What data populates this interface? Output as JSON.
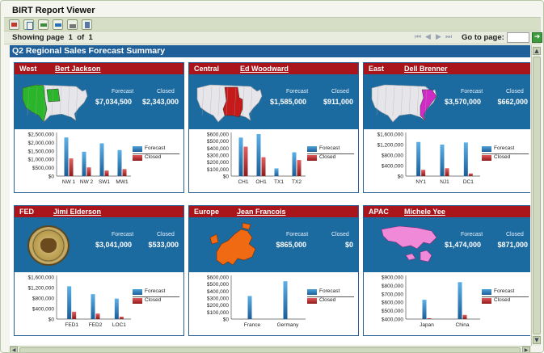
{
  "app": {
    "title": "BIRT Report Viewer"
  },
  "toolbar": {
    "icons": [
      "pdf-export-icon",
      "toc-icon",
      "export-report-icon",
      "export-data-icon",
      "print-icon",
      "print-server-icon"
    ]
  },
  "nav": {
    "showing_prefix": "Showing page",
    "page": "1",
    "of_label": "of",
    "total": "1",
    "goto_label": "Go to page:",
    "goto_value": "",
    "goto_button": "➜"
  },
  "report": {
    "title": "Q2 Regional Sales Forecast Summary"
  },
  "labels": {
    "forecast": "Forecast",
    "closed": "Closed"
  },
  "colors": {
    "header_red": "#a9151b",
    "panel_blue": "#1b6aa0",
    "title_blue": "#1f5f9a",
    "forecast_bar": "#2b7cc1",
    "closed_bar": "#b22222"
  },
  "panels": [
    {
      "region": "West",
      "rep": "Bert Jackson",
      "forecast": "$7,034,500",
      "closed": "$2,343,000",
      "image": "us-map-west",
      "chart_data": {
        "type": "bar",
        "categories": [
          "NW 1",
          "NW 2",
          "SW1",
          "MW1"
        ],
        "series": [
          {
            "name": "Forecast",
            "values": [
              2300000,
              1450000,
              1950000,
              1550000
            ]
          },
          {
            "name": "Closed",
            "values": [
              1050000,
              520000,
              330000,
              420000
            ]
          }
        ],
        "ylim": [
          0,
          2500000
        ],
        "yticks": [
          "$0",
          "$500,000",
          "$1,000,000",
          "$1,500,000",
          "$2,000,000",
          "$2,500,000"
        ]
      }
    },
    {
      "region": "Central",
      "rep": "Ed Woodward",
      "forecast": "$1,585,000",
      "closed": "$911,000",
      "image": "us-map-central",
      "chart_data": {
        "type": "bar",
        "categories": [
          "CH1",
          "OH1",
          "TX1",
          "TX2"
        ],
        "series": [
          {
            "name": "Forecast",
            "values": [
              550000,
              600000,
              110000,
              340000
            ]
          },
          {
            "name": "Closed",
            "values": [
              420000,
              270000,
              0,
              230000
            ]
          }
        ],
        "ylim": [
          0,
          600000
        ],
        "yticks": [
          "$0",
          "$100,000",
          "$200,000",
          "$300,000",
          "$400,000",
          "$500,000",
          "$600,000"
        ]
      }
    },
    {
      "region": "East",
      "rep": "Dell Brenner",
      "forecast": "$3,570,000",
      "closed": "$662,000",
      "image": "us-map-east",
      "chart_data": {
        "type": "bar",
        "categories": [
          "NY1",
          "NJ1",
          "DC1"
        ],
        "series": [
          {
            "name": "Forecast",
            "values": [
              1300000,
              1200000,
              1280000
            ]
          },
          {
            "name": "Closed",
            "values": [
              240000,
              300000,
              100000
            ]
          }
        ],
        "ylim": [
          0,
          1600000
        ],
        "yticks": [
          "$0",
          "$400,000",
          "$800,000",
          "$1,200,000",
          "$1,600,000"
        ]
      }
    },
    {
      "region": "FED",
      "rep": "Jimi Elderson",
      "forecast": "$3,041,000",
      "closed": "$533,000",
      "image": "great-seal",
      "chart_data": {
        "type": "bar",
        "categories": [
          "FED1",
          "FED2",
          "LOC1"
        ],
        "series": [
          {
            "name": "Forecast",
            "values": [
              1250000,
              950000,
              780000
            ]
          },
          {
            "name": "Closed",
            "values": [
              280000,
              210000,
              90000
            ]
          }
        ],
        "ylim": [
          0,
          1600000
        ],
        "yticks": [
          "$0",
          "$400,000",
          "$800,000",
          "$1,200,000",
          "$1,600,000"
        ]
      }
    },
    {
      "region": "Europe",
      "rep": "Jean Francois",
      "forecast": "$865,000",
      "closed": "$0",
      "image": "europe-map",
      "chart_data": {
        "type": "bar",
        "categories": [
          "France",
          "Germany"
        ],
        "series": [
          {
            "name": "Forecast",
            "values": [
              330000,
              540000
            ]
          },
          {
            "name": "Closed",
            "values": [
              0,
              0
            ]
          }
        ],
        "ylim": [
          0,
          600000
        ],
        "yticks": [
          "$0",
          "$100,000",
          "$200,000",
          "$300,000",
          "$400,000",
          "$500,000",
          "$600,000"
        ]
      }
    },
    {
      "region": "APAC",
      "rep": "Michele Yee",
      "forecast": "$1,474,000",
      "closed": "$871,000",
      "image": "apac-map",
      "chart_data": {
        "type": "bar",
        "categories": [
          "Japan",
          "China"
        ],
        "series": [
          {
            "name": "Forecast",
            "values": [
              630000,
              840000
            ]
          },
          {
            "name": "Closed",
            "values": [
              410000,
              450000
            ]
          }
        ],
        "ylim": [
          400000,
          900000
        ],
        "yticks": [
          "$400,000",
          "$500,000",
          "$600,000",
          "$700,000",
          "$800,000",
          "$900,000"
        ]
      }
    }
  ]
}
